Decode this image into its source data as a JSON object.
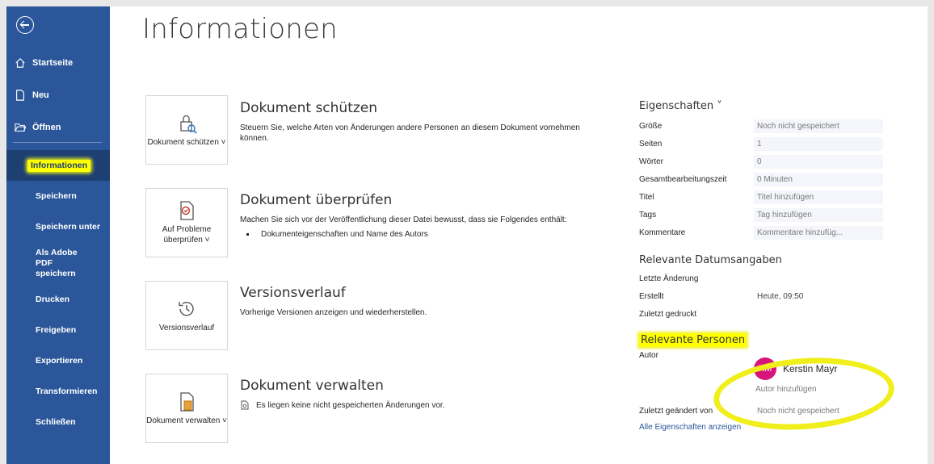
{
  "sidebar": {
    "top_items": [
      {
        "label": "Startseite",
        "icon": "home-icon"
      },
      {
        "label": "Neu",
        "icon": "new-doc-icon"
      },
      {
        "label": "Öffnen",
        "icon": "folder-open-icon"
      }
    ],
    "items": [
      {
        "label": "Informationen",
        "active": true
      },
      {
        "label": "Speichern"
      },
      {
        "label": "Speichern unter"
      },
      {
        "label": "Als Adobe PDF speichern"
      },
      {
        "label": "Drucken"
      },
      {
        "label": "Freigeben"
      },
      {
        "label": "Exportieren"
      },
      {
        "label": "Transformieren"
      },
      {
        "label": "Schließen"
      }
    ]
  },
  "main": {
    "title": "Informationen",
    "sections": [
      {
        "card_label": "Dokument schützen ˅",
        "card_icon": "lock-icon",
        "heading": "Dokument schützen",
        "text": "Steuern Sie, welche Arten von Änderungen andere Personen an diesem Dokument vornehmen können."
      },
      {
        "card_label": "Auf Probleme überprüfen ˅",
        "card_icon": "inspect-icon",
        "heading": "Dokument überprüfen",
        "text": "Machen Sie sich vor der Veröffentlichung dieser Datei bewusst, dass sie Folgendes enthält:",
        "bullets": [
          "Dokumenteigenschaften und Name des Autors"
        ]
      },
      {
        "card_label": "Versionsverlauf",
        "card_icon": "history-icon",
        "heading": "Versionsverlauf",
        "text": "Vorherige Versionen anzeigen und wiederherstellen."
      },
      {
        "card_label": "Dokument verwalten ˅",
        "card_icon": "manage-document-icon",
        "heading": "Dokument verwalten",
        "text": "Es liegen keine nicht gespeicherten Änderungen vor."
      }
    ]
  },
  "properties": {
    "title": "Eigenschaften ˅",
    "rows": [
      {
        "key": "Größe",
        "value": "Noch nicht gespeichert"
      },
      {
        "key": "Seiten",
        "value": "1"
      },
      {
        "key": "Wörter",
        "value": "0"
      },
      {
        "key": "Gesamtbearbeitungszeit",
        "value": "0 Minuten"
      },
      {
        "key": "Titel",
        "value": "Titel hinzufügen"
      },
      {
        "key": "Tags",
        "value": "Tag hinzufügen"
      },
      {
        "key": "Kommentare",
        "value": "Kommentare hinzufüg..."
      }
    ],
    "dates_title": "Relevante Datumsangaben",
    "dates": [
      {
        "key": "Letzte Änderung",
        "value": ""
      },
      {
        "key": "Erstellt",
        "value": "Heute, 09:50"
      },
      {
        "key": "Zuletzt gedruckt",
        "value": ""
      }
    ],
    "people_title": "Relevante Personen",
    "author_key": "Autor",
    "author_initials": "KM",
    "author_name": "Kerstin Mayr",
    "add_author": "Autor hinzufügen",
    "last_modified_by_key": "Zuletzt geändert von",
    "last_modified_by_value": "Noch nicht gespeichert",
    "all_props_link": "Alle Eigenschaften anzeigen"
  },
  "colors": {
    "sidebar": "#2b579a",
    "highlight": "#ffff00",
    "avatar": "#d6147a"
  }
}
